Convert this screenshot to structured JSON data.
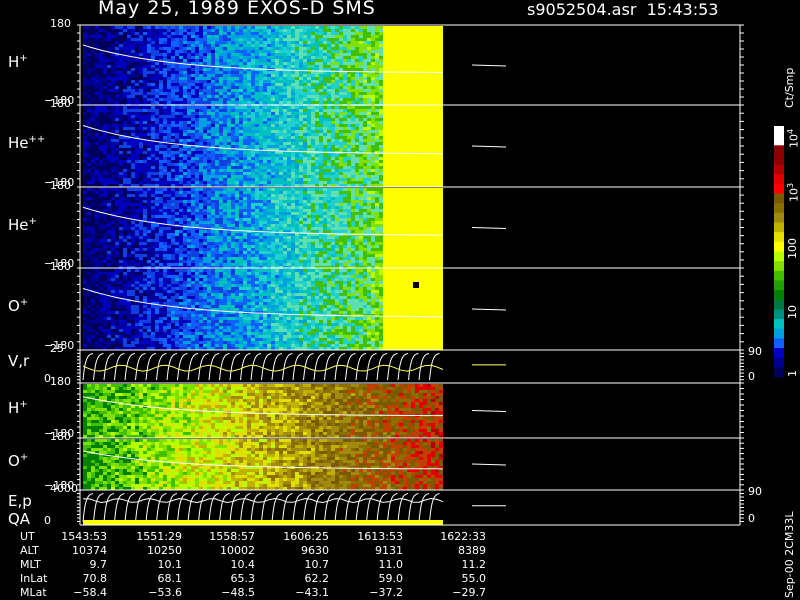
{
  "header": {
    "title": "May 25, 1989   EXOS-D SMS",
    "file": "s9052504.asr",
    "time": "15:43:53"
  },
  "panels": [
    {
      "id": "h1",
      "species": "H",
      "charge": "+",
      "top_tick": "180",
      "bottom_tick": "−180",
      "kind": "spec",
      "palette": "cool"
    },
    {
      "id": "he2",
      "species": "He",
      "charge": "++",
      "top_tick": "180",
      "bottom_tick": "−180",
      "kind": "spec",
      "palette": "cool"
    },
    {
      "id": "he1",
      "species": "He",
      "charge": "+",
      "top_tick": "180",
      "bottom_tick": "−180",
      "kind": "spec",
      "palette": "cool"
    },
    {
      "id": "o1",
      "species": "O",
      "charge": "+",
      "top_tick": "180",
      "bottom_tick": "−180",
      "kind": "spec",
      "palette": "cool"
    },
    {
      "id": "vr",
      "species": "V,r",
      "charge": "",
      "top_tick": "25",
      "bottom_tick": "0",
      "right_top": "90",
      "right_bottom": "0",
      "kind": "lines"
    },
    {
      "id": "h2",
      "species": "H",
      "charge": "+",
      "top_tick": "180",
      "bottom_tick": "−180",
      "kind": "spec",
      "palette": "warm"
    },
    {
      "id": "o2",
      "species": "O",
      "charge": "+",
      "top_tick": "180",
      "bottom_tick": "−180",
      "kind": "spec",
      "palette": "warm"
    },
    {
      "id": "ep",
      "species": "E,p",
      "charge": "",
      "species2": "QA",
      "top_tick": "4000",
      "bottom_tick": "0",
      "right_top": "90",
      "right_bottom": "0",
      "kind": "lines"
    }
  ],
  "colorbar": {
    "unit_label": "Ct/Smp",
    "labels": [
      {
        "text": "10",
        "sup": "4"
      },
      {
        "text": "10",
        "sup": "3"
      },
      {
        "text": "100",
        "sup": ""
      },
      {
        "text": "10",
        "sup": ""
      },
      {
        "text": "1",
        "sup": ""
      }
    ],
    "colors": [
      "#ffffff",
      "#ffffff",
      "#8b0000",
      "#8b0000",
      "#b00000",
      "#e00000",
      "#ff0000",
      "#7a5a00",
      "#8a6e00",
      "#a08a10",
      "#c0b000",
      "#e8e000",
      "#ffff00",
      "#b8ff00",
      "#80e000",
      "#40c000",
      "#20a000",
      "#008000",
      "#007a40",
      "#009080",
      "#00c0c0",
      "#00a0e0",
      "#1060ff",
      "#0000c0",
      "#000090",
      "#00005a"
    ]
  },
  "footer_side": "Sep-00  2CM33L",
  "ephemeris": {
    "labels": [
      "UT",
      "ALT",
      "MLT",
      "InLat",
      "MLat"
    ],
    "columns": [
      [
        "1543:53",
        "10374",
        "9.7",
        "70.8",
        "−58.4"
      ],
      [
        "1551:29",
        "10250",
        "10.1",
        "68.1",
        "−53.6"
      ],
      [
        "1558:57",
        "10002",
        "10.4",
        "65.3",
        "−48.5"
      ],
      [
        "1606:25",
        "9630",
        "10.7",
        "62.2",
        "−43.1"
      ],
      [
        "1613:53",
        "9131",
        "11.0",
        "59.0",
        "−37.2"
      ],
      [
        "1622:33",
        "8389",
        "11.2",
        "55.0",
        "−29.7"
      ]
    ]
  }
}
